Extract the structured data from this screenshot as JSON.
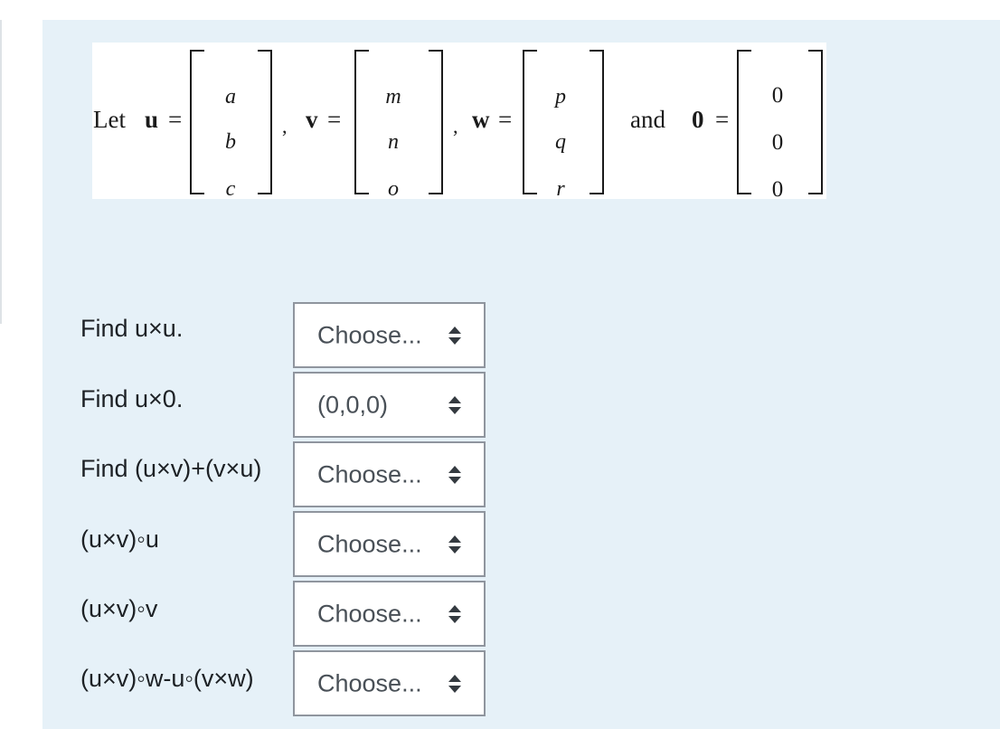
{
  "problem": {
    "let_text": "Let",
    "u_name": "u",
    "v_name": "v",
    "w_name": "w",
    "zero_name": "0",
    "equals": "=",
    "comma": ",",
    "and_text": "and",
    "u_entries": [
      "a",
      "b",
      "c"
    ],
    "v_entries": [
      "m",
      "n",
      "o"
    ],
    "w_entries": [
      "p",
      "q",
      "r"
    ],
    "zero_entries": [
      "0",
      "0",
      "0"
    ]
  },
  "questions": [
    {
      "label": "Find  u×u.",
      "selected": "Choose..."
    },
    {
      "label": "Find  u×0.",
      "selected": "(0,0,0)"
    },
    {
      "label": "Find  (u×v)+(v×u)",
      "selected": "Choose..."
    },
    {
      "label": "(u×v)◦u",
      "selected": "Choose..."
    },
    {
      "label": "(u×v)◦v",
      "selected": "Choose..."
    },
    {
      "label": "(u×v)◦w-u◦(v×w)",
      "selected": "Choose..."
    }
  ]
}
